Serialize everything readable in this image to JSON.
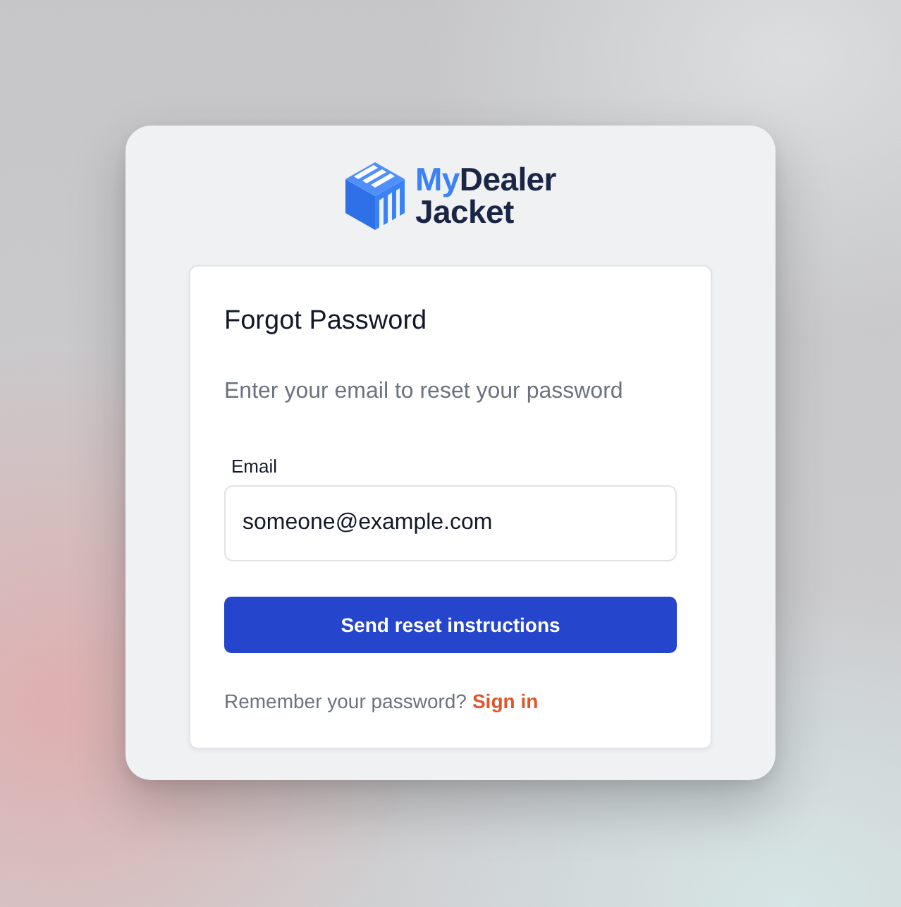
{
  "logo": {
    "accent": "My",
    "name": "Dealer",
    "second_line": "Jacket"
  },
  "form": {
    "title": "Forgot Password",
    "subtitle": "Enter your email to reset your password",
    "fields": [
      {
        "label": "Email",
        "value": "someone@example.com"
      }
    ],
    "submit": "Send reset instructions",
    "footer": {
      "text": "Remember your password?",
      "link": "Sign in"
    }
  }
}
